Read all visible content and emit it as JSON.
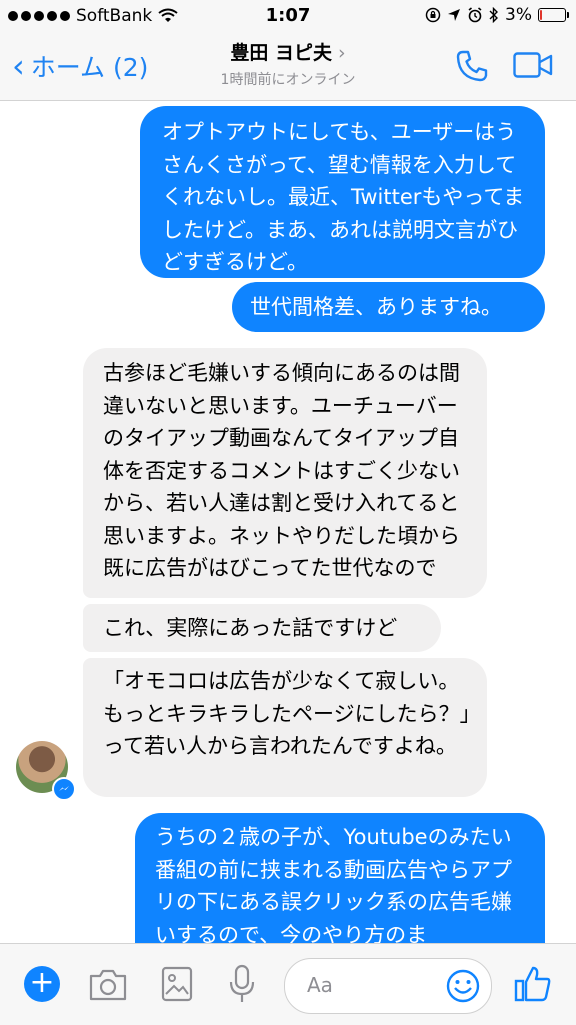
{
  "status_bar": {
    "carrier": "SoftBank",
    "time": "1:07",
    "battery_percent": "3%",
    "battery_level": 0.03,
    "colors": {
      "battery_low": "#e0352b"
    }
  },
  "nav": {
    "back_label": "ホーム (2)",
    "contact_name": "豊田 ヨピ夫",
    "contact_status": "1時間前にオンライン",
    "colors": {
      "accent": "#1f83f2"
    }
  },
  "messages": [
    {
      "from": "me",
      "text": "オプトアウトにしても、ユーザーはうさんくさがって、望む情報を入力してくれないし。最近、Twitterもやってましたけど。まあ、あれは説明文言がひどすぎるけど。"
    },
    {
      "from": "me",
      "text": "世代間格差、ありますね。"
    },
    {
      "from": "them",
      "text": "古参ほど毛嫌いする傾向にあるのは間違いないと思います。ユーチューバーのタイアップ動画なんてタイアップ自体を否定するコメントはすごく少ないから、若い人達は割と受け入れてると思いますよ。ネットやりだした頃から既に広告がはびこってた世代なので"
    },
    {
      "from": "them",
      "text": "これ、実際にあった話ですけど"
    },
    {
      "from": "them",
      "text": "「オモコロは広告が少なくて寂しい。もっとキラキラしたページにしたら？」って若い人から言われたんですよね。"
    },
    {
      "from": "me",
      "text": "うちの２歳の子が、Youtubeのみたい番組の前に挟まれる動画広告やらアプリの下にある誤クリック系の広告毛嫌いするので、今のやり方のま"
    }
  ],
  "toolbar": {
    "composer_placeholder": "Aa",
    "icons": [
      "plus-icon",
      "camera-icon",
      "photo-icon",
      "microphone-icon",
      "emoji-icon",
      "like-icon"
    ]
  },
  "colors": {
    "outgoing_bubble": "#0f84ff",
    "incoming_bubble": "#f1f0f0"
  }
}
